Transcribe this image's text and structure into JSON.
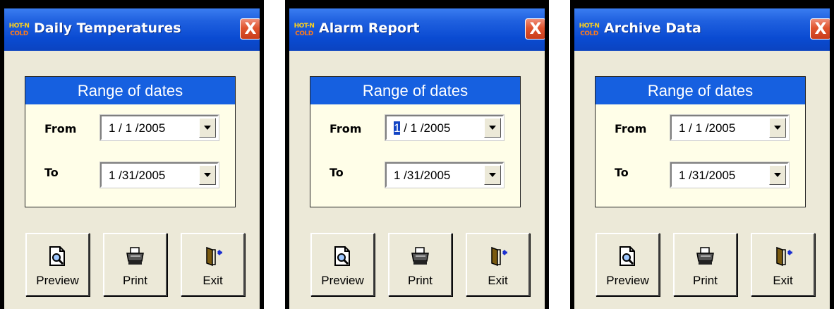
{
  "logo_text": [
    "HOT-N",
    "COLD"
  ],
  "windows": [
    {
      "title": "Daily Temperatures",
      "close_label": "X",
      "range": {
        "header": "Range of dates",
        "from_label": "From",
        "from_value": "1 / 1 /2005",
        "to_label": "To",
        "to_value": "1 /31/2005"
      },
      "buttons": {
        "preview": "Preview",
        "print": "Print",
        "exit": "Exit"
      }
    },
    {
      "title": "Alarm Report",
      "close_label": "X",
      "range": {
        "header": "Range of dates",
        "from_label": "From",
        "from_value_selected": "1",
        "from_value_rest": " / 1 /2005",
        "to_label": "To",
        "to_value": "1 /31/2005"
      },
      "buttons": {
        "preview": "Preview",
        "print": "Print",
        "exit": "Exit"
      }
    },
    {
      "title": "Archive Data",
      "close_label": "X",
      "range": {
        "header": "Range of dates",
        "from_label": "From",
        "from_value": "1 / 1 /2005",
        "to_label": "To",
        "to_value": "1 /31/2005"
      },
      "buttons": {
        "preview": "Preview",
        "print": "Print",
        "exit": "Exit"
      }
    }
  ]
}
